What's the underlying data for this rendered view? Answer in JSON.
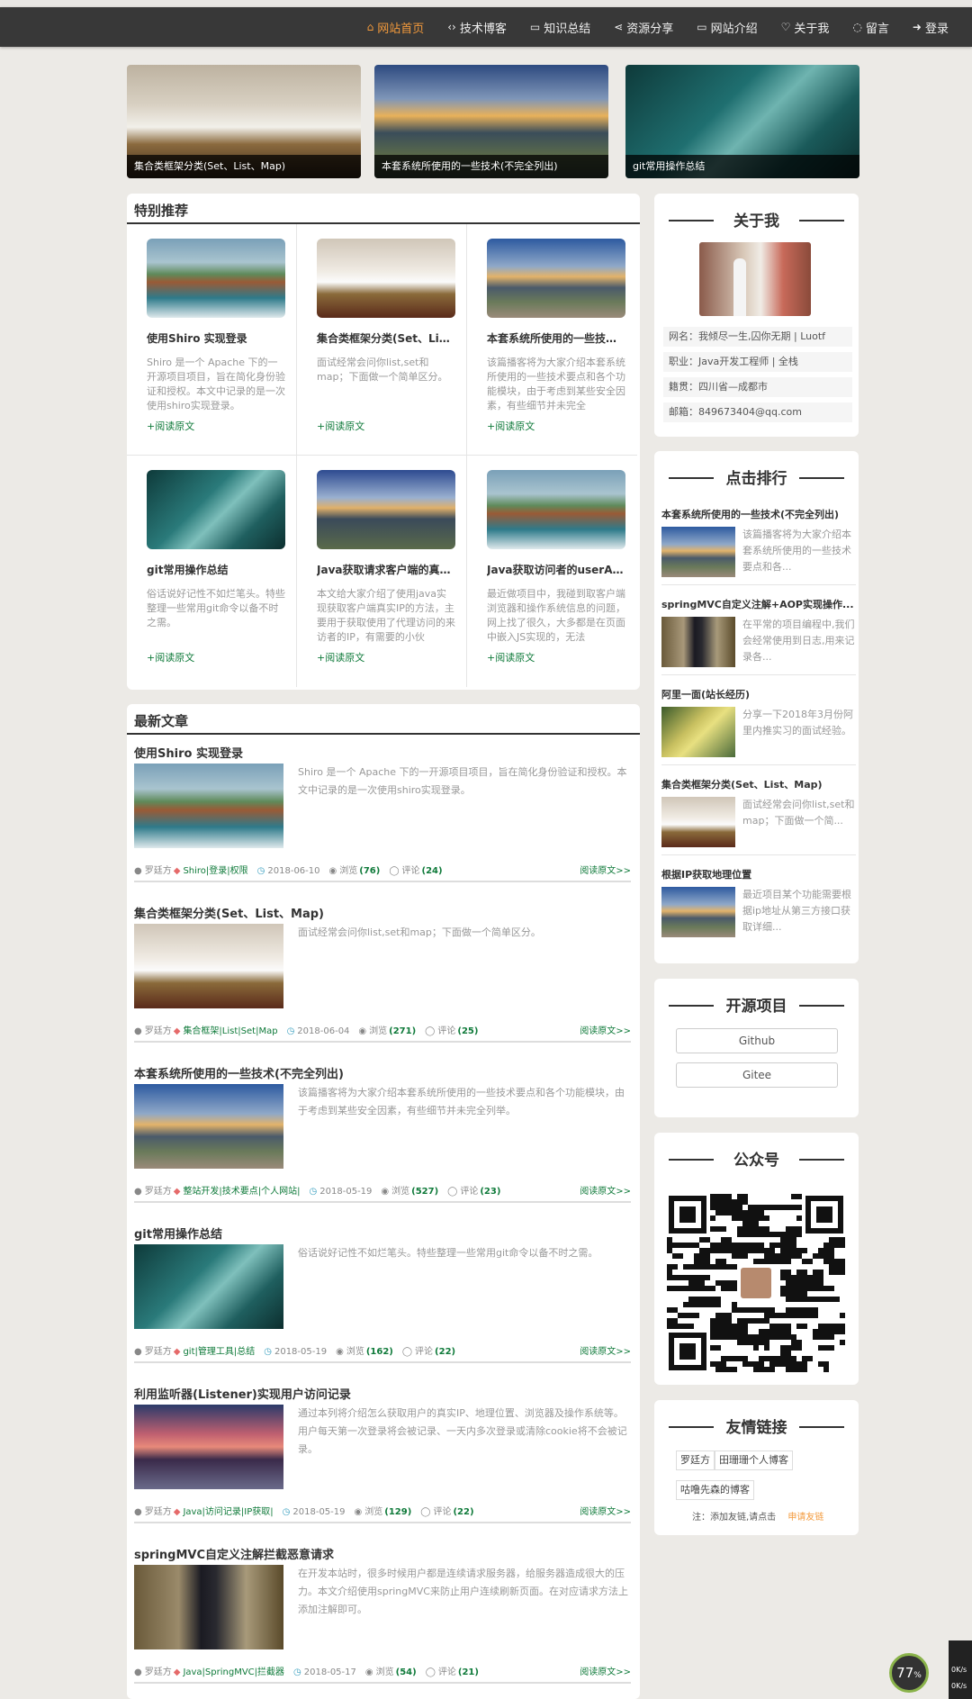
{
  "nav": {
    "items": [
      {
        "label": "网站首页",
        "icon": "home-icon"
      },
      {
        "label": "技术博客",
        "icon": "code-icon"
      },
      {
        "label": "知识总结",
        "icon": "folder-icon"
      },
      {
        "label": "资源分享",
        "icon": "share-icon"
      },
      {
        "label": "网站介绍",
        "icon": "monitor-icon"
      },
      {
        "label": "关于我",
        "icon": "heart-icon"
      },
      {
        "label": "留言",
        "icon": "comment-icon"
      },
      {
        "label": "登录",
        "icon": "login-icon"
      }
    ]
  },
  "banners": [
    {
      "caption": "集合类框架分类(Set、List、Map)"
    },
    {
      "caption": "本套系统所使用的一些技术(不完全列出)"
    },
    {
      "caption": "git常用操作总结"
    }
  ],
  "recommend": {
    "title": "特别推荐",
    "items": [
      {
        "title": "使用Shiro 实现登录",
        "desc": "Shiro 是一个 Apache 下的一开源项目项目，旨在简化身份验证和授权。本文中记录的是一次使用shiro实现登录。",
        "more": "+阅读原文"
      },
      {
        "title": "集合类框架分类(Set、List...",
        "desc": "面试经常会问你list,set和map；下面做一个简单区分。",
        "more": "+阅读原文"
      },
      {
        "title": "本套系统所使用的一些技术(...",
        "desc": "该篇播客将为大家介绍本套系统所使用的一些技术要点和各个功能模块，由于考虑到某些安全因素，有些细节并未完全",
        "more": "+阅读原文"
      },
      {
        "title": "git常用操作总结",
        "desc": "俗话说好记性不如烂笔头。特些整理一些常用git命令以备不时之需。",
        "more": "+阅读原文"
      },
      {
        "title": "Java获取请求客户端的真实I...",
        "desc": "本文给大家介绍了使用java实现获取客户端真实IP的方法，主要用于获取使用了代理访问的来访者的IP，有需要的小伙",
        "more": "+阅读原文"
      },
      {
        "title": "Java获取访问者的userAge...",
        "desc": "最近做项目中，我碰到取客户端浏览器和操作系统信息的问题，网上找了很久，大多都是在页面中嵌入JS实现的，无法",
        "more": "+阅读原文"
      }
    ]
  },
  "latest": {
    "title": "最新文章",
    "articles": [
      {
        "title": "使用Shiro 实现登录",
        "desc": "Shiro 是一个 Apache 下的一开源项目项目，旨在简化身份验证和授权。本文中记录的是一次使用shiro实现登录。",
        "author": "罗廷方",
        "tags": "Shiro|登录|权限",
        "date": "2018-06-10",
        "views_label": "浏览",
        "views": "(76)",
        "comments_label": "评论",
        "comments": "(24)",
        "more": "阅读原文>>"
      },
      {
        "title": "集合类框架分类(Set、List、Map)",
        "desc": "面试经常会问你list,set和map；下面做一个简单区分。",
        "author": "罗廷方",
        "tags": "集合框架|List|Set|Map",
        "date": "2018-06-04",
        "views_label": "浏览",
        "views": "(271)",
        "comments_label": "评论",
        "comments": "(25)",
        "more": "阅读原文>>"
      },
      {
        "title": "本套系统所使用的一些技术(不完全列出)",
        "desc": "该篇播客将为大家介绍本套系统所使用的一些技术要点和各个功能模块，由于考虑到某些安全因素，有些细节并未完全列举。",
        "author": "罗廷方",
        "tags": "整站开发|技术要点|个人网站|",
        "date": "2018-05-19",
        "views_label": "浏览",
        "views": "(527)",
        "comments_label": "评论",
        "comments": "(23)",
        "more": "阅读原文>>"
      },
      {
        "title": "git常用操作总结",
        "desc": "俗话说好记性不如烂笔头。特些整理一些常用git命令以备不时之需。",
        "author": "罗廷方",
        "tags": "git|管理工具|总结",
        "date": "2018-05-19",
        "views_label": "浏览",
        "views": "(162)",
        "comments_label": "评论",
        "comments": "(22)",
        "more": "阅读原文>>"
      },
      {
        "title": "利用监听器(Listener)实现用户访问记录",
        "desc": "通过本列将介绍怎么获取用户的真实IP、地理位置、浏览器及操作系统等。用户每天第一次登录将会被记录、一天内多次登录或清除cookie将不会被记录。",
        "author": "罗廷方",
        "tags": "Java|访问记录|IP获取|",
        "date": "2018-05-19",
        "views_label": "浏览",
        "views": "(129)",
        "comments_label": "评论",
        "comments": "(22)",
        "more": "阅读原文>>"
      },
      {
        "title": "springMVC自定义注解拦截恶意请求",
        "desc": "在开发本站时，很多时候用户都是连续请求服务器，给服务器造成很大的压力。本文介绍使用springMVC来防止用户连续刷新页面。在对应请求方法上添加注解即可。",
        "author": "罗廷方",
        "tags": "Java|SpringMVC|拦截器",
        "date": "2018-05-17",
        "views_label": "浏览",
        "views": "(54)",
        "comments_label": "评论",
        "comments": "(21)",
        "more": "阅读原文>>"
      }
    ]
  },
  "about": {
    "title": "关于我",
    "rows": [
      "网名：我倾尽一生,囚你无期 | Luotf",
      "职业：Java开发工程师 | 全栈",
      "籍贯：四川省—成都市",
      "邮箱：849673404@qq.com"
    ]
  },
  "ranking": {
    "title": "点击排行",
    "items": [
      {
        "title": "本套系统所使用的一些技术(不完全列出)",
        "desc": "该篇播客将为大家介绍本套系统所使用的一些技术要点和各..."
      },
      {
        "title": "springMVC自定义注解+AOP实现操作...",
        "desc": "在平常的项目编程中,我们会经常使用到日志,用来记录各..."
      },
      {
        "title": "阿里一面(站长经历)",
        "desc": "分享一下2018年3月份阿里内推实习的面试经验。"
      },
      {
        "title": "集合类框架分类(Set、List、Map)",
        "desc": "面试经常会问你list,set和map；下面做一个简..."
      },
      {
        "title": "根据IP获取地理位置",
        "desc": "最近项目某个功能需要根据ip地址从第三方接口获取详细..."
      }
    ]
  },
  "opensource": {
    "title": "开源项目",
    "buttons": [
      "Github",
      "Gitee"
    ]
  },
  "wechat": {
    "title": "公众号"
  },
  "friends": {
    "title": "友情链接",
    "links": [
      "罗廷方",
      "田珊珊个人博客",
      "咕噜先森的博客"
    ],
    "note": "注：添加友链,请点击",
    "apply": "申请友链"
  },
  "widget": {
    "percent": "77",
    "unit": "%",
    "up": "0K/s",
    "down": "0K/s"
  }
}
